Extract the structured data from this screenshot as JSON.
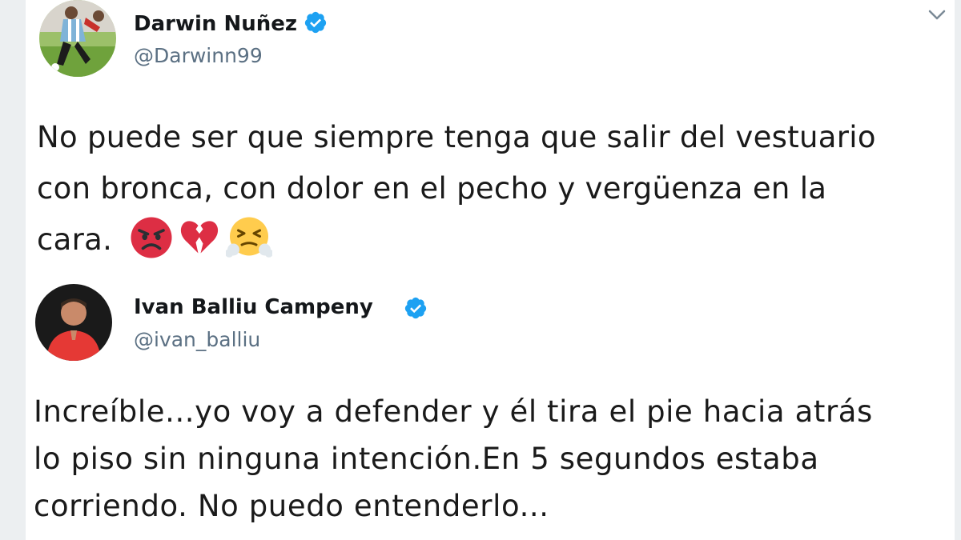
{
  "tweets": [
    {
      "display_name": "Darwin Nuñez",
      "handle": "@Darwinn99",
      "text_lines": [
        "No puede ser que siempre tenga que salir del vestuario",
        "con bronca, con dolor en el pecho y vergüenza en la",
        "cara."
      ],
      "emojis": [
        "angry-face-icon",
        "broken-heart-icon",
        "steam-from-nose-face-icon"
      ],
      "verified": true
    },
    {
      "display_name": "Ivan Balliu Campeny",
      "handle": "@ivan_balliu",
      "text_lines": [
        "Increíble...yo voy a defender y él tira el pie hacia atrás",
        "lo piso sin ninguna intención.En 5 segundos estaba",
        "corriendo. No puedo entenderlo..."
      ],
      "verified": true
    }
  ],
  "colors": {
    "verified_blue": "#1da1f2",
    "handle_gray": "#5b7083",
    "text": "#1a1a1a"
  }
}
